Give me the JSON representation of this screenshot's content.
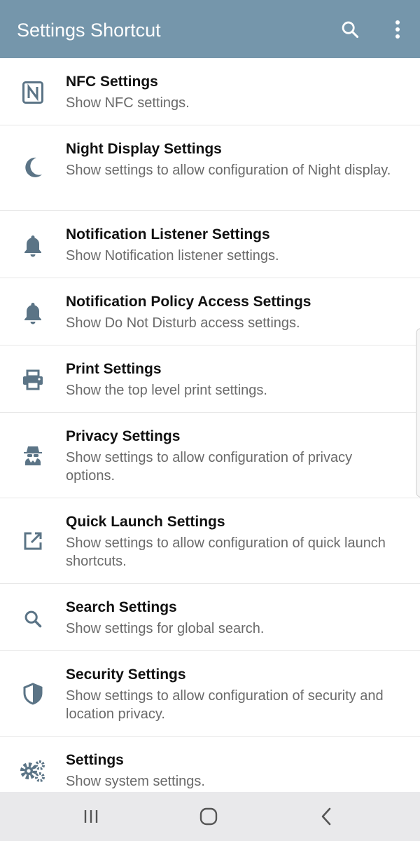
{
  "app": {
    "title": "Settings Shortcut",
    "accent": "#7596ab",
    "actions": {
      "search_icon": "search-icon",
      "more_icon": "more-vert-icon"
    }
  },
  "items": [
    {
      "title": "NFC Settings",
      "subtitle": "Show NFC settings.",
      "icon": "nfc-icon"
    },
    {
      "title": "Night Display Settings",
      "subtitle": "Show settings to allow configuration of Night display.",
      "icon": "moon-icon"
    },
    {
      "title": "Notification Listener Settings",
      "subtitle": "Show Notification listener settings.",
      "icon": "bell-icon"
    },
    {
      "title": "Notification Policy Access Settings",
      "subtitle": "Show Do Not Disturb access settings.",
      "icon": "bell-icon"
    },
    {
      "title": "Print Settings",
      "subtitle": "Show the top level print settings.",
      "icon": "printer-icon"
    },
    {
      "title": "Privacy Settings",
      "subtitle": "Show settings to allow configuration of privacy options.",
      "icon": "spy-icon"
    },
    {
      "title": "Quick Launch Settings",
      "subtitle": "Show settings to allow configuration of quick launch shortcuts.",
      "icon": "external-link-icon"
    },
    {
      "title": "Search Settings",
      "subtitle": "Show settings for global search.",
      "icon": "search-icon"
    },
    {
      "title": "Security Settings",
      "subtitle": "Show settings to allow configuration of security and location privacy.",
      "icon": "shield-icon"
    },
    {
      "title": "Settings",
      "subtitle": "Show system settings.",
      "icon": "gears-icon"
    }
  ],
  "navbar": {
    "recents_icon": "recents-icon",
    "home_icon": "home-icon",
    "back_icon": "back-icon"
  }
}
